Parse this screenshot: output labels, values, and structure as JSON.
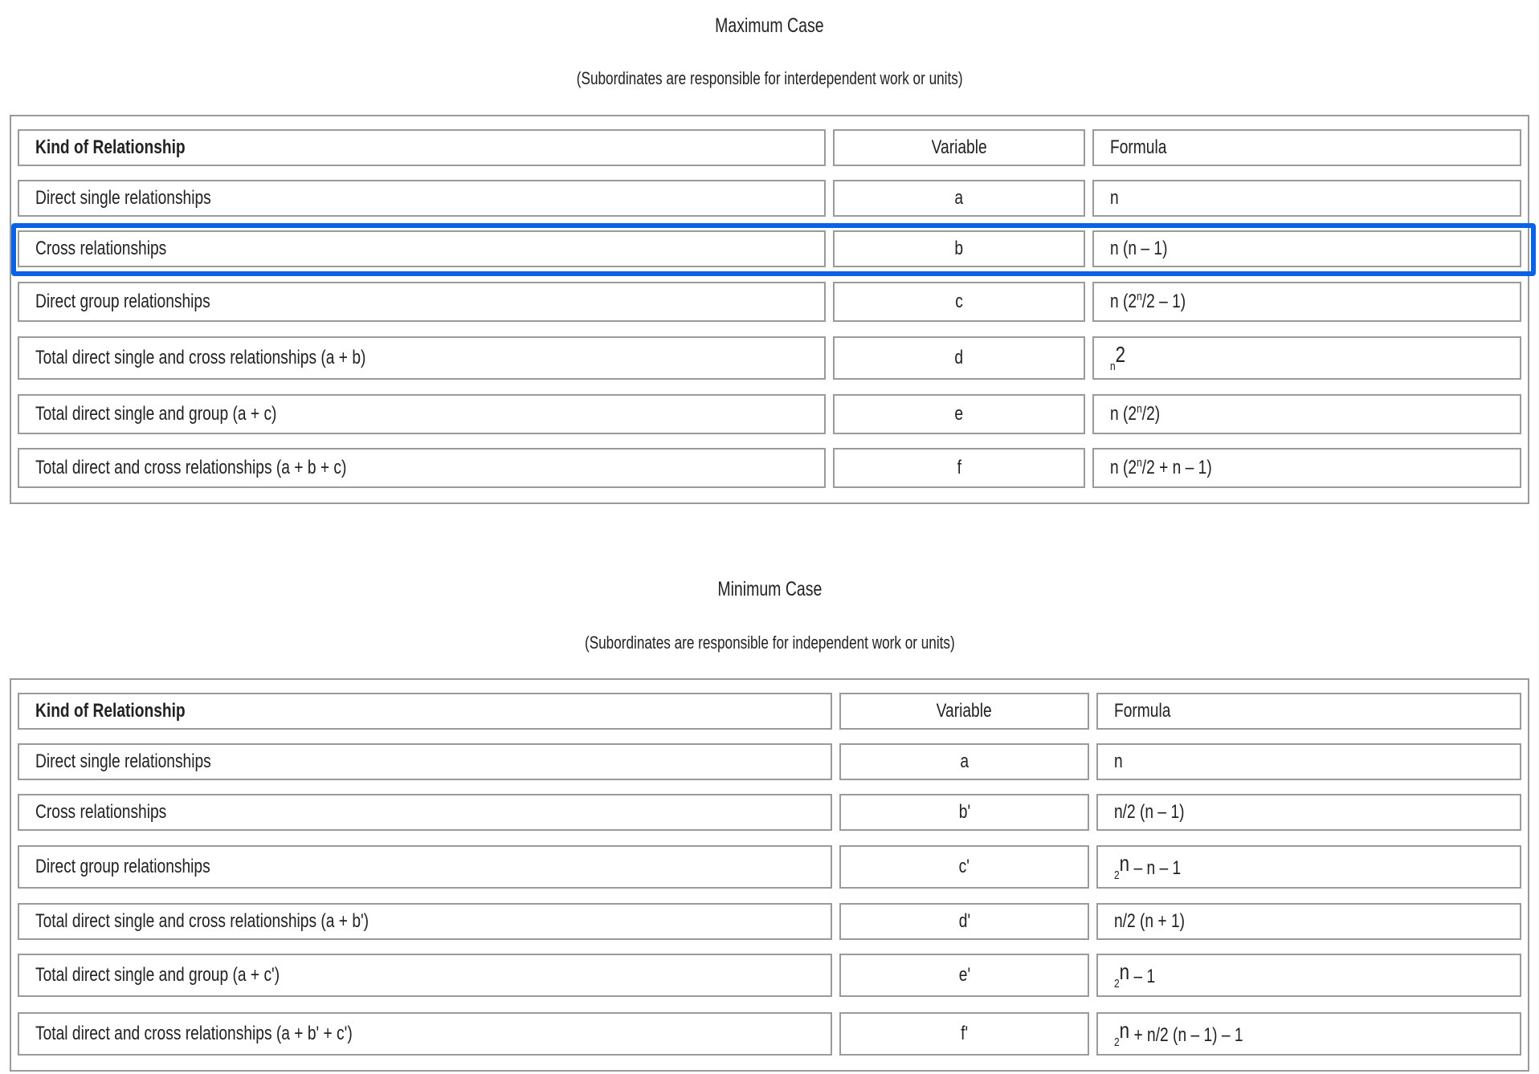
{
  "max": {
    "title": "Maximum Case",
    "subtitle": "(Subordinates are responsible for interdependent work or units)",
    "headers": {
      "kind": "Kind of Relationship",
      "variable": "Variable",
      "formula": "Formula"
    },
    "rows": [
      {
        "kind": "Direct single relationships",
        "variable": "a",
        "formula": "n"
      },
      {
        "kind": "Cross relationships",
        "variable": "b",
        "formula": "n (n – 1)"
      },
      {
        "kind": "Direct group relationships",
        "variable": "c",
        "formula_a": "n (2",
        "formula_sup": "n",
        "formula_b": "/2 – 1)"
      },
      {
        "kind": "Total direct single and cross relationships (a + b)",
        "variable": "d",
        "formula_a": "n",
        "formula_b": "2"
      },
      {
        "kind": "Total direct single and group (a + c)",
        "variable": "e",
        "formula_a": "n (2",
        "formula_sup": "n",
        "formula_b": "/2)"
      },
      {
        "kind": "Total direct and cross relationships (a + b + c)",
        "variable": "f",
        "formula_a": "n (2",
        "formula_sup": "n",
        "formula_b": "/2 + n – 1)"
      }
    ]
  },
  "min": {
    "title": "Minimum Case",
    "subtitle": "(Subordinates are responsible for independent work or units)",
    "headers": {
      "kind": "Kind of Relationship",
      "variable": "Variable",
      "formula": "Formula"
    },
    "rows": [
      {
        "kind": "Direct single relationships",
        "variable": "a",
        "formula": "n"
      },
      {
        "kind": "Cross relationships",
        "variable": "b'",
        "formula": "n/2 (n – 1)"
      },
      {
        "kind": "Direct group relationships",
        "variable": "c'",
        "formula_a": "2",
        "formula_sup": "n",
        "formula_b": " – n – 1"
      },
      {
        "kind": "Total direct single and cross relationships (a + b')",
        "variable": "d'",
        "formula": "n/2 (n + 1)"
      },
      {
        "kind": "Total direct single and group (a + c')",
        "variable": "e'",
        "formula_a": "2",
        "formula_sup": "n",
        "formula_b": " – 1"
      },
      {
        "kind": "Total direct and cross relationships (a + b' + c')",
        "variable": "f'",
        "formula_a": "2",
        "formula_sup": "n",
        "formula_b": " + n/2 (n – 1) – 1"
      }
    ]
  },
  "highlight_color": "#0a63e6",
  "border_color": "#9a9a9a"
}
